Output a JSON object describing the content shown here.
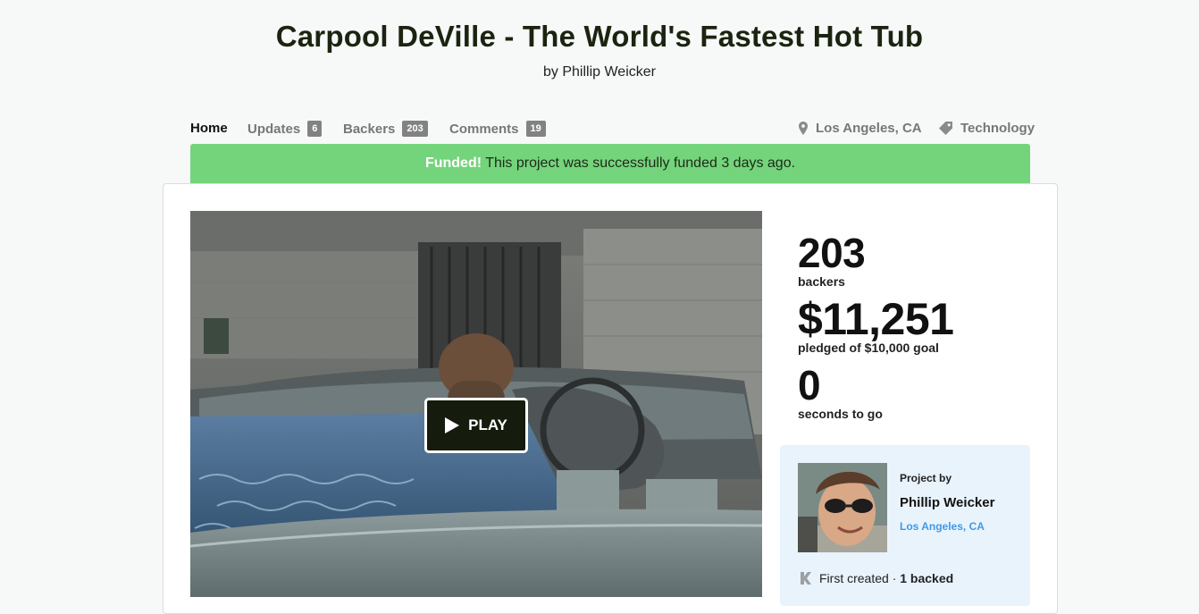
{
  "project": {
    "title": "Carpool DeVille - The World's Fastest Hot Tub",
    "byline": "by Phillip Weicker"
  },
  "nav": {
    "home": "Home",
    "updates": {
      "label": "Updates",
      "count": "6"
    },
    "backers": {
      "label": "Backers",
      "count": "203"
    },
    "comments": {
      "label": "Comments",
      "count": "19"
    },
    "location": "Los Angeles, CA",
    "category": "Technology"
  },
  "banner": {
    "strong": "Funded!",
    "text": " This project was successfully funded 3 days ago.",
    "color": "#74d47c"
  },
  "video": {
    "play_label": "PLAY"
  },
  "stats": {
    "backers_count": "203",
    "backers_label": "backers",
    "pledged": "$11,251",
    "pledged_label": "pledged of $10,000 goal",
    "time_left": "0",
    "time_label": "seconds to go"
  },
  "creator": {
    "heading": "Project by",
    "name": "Phillip Weicker",
    "location": "Los Angeles, CA",
    "created": "First created · ",
    "backed": "1 backed",
    "link_color": "#3d9ae8"
  }
}
